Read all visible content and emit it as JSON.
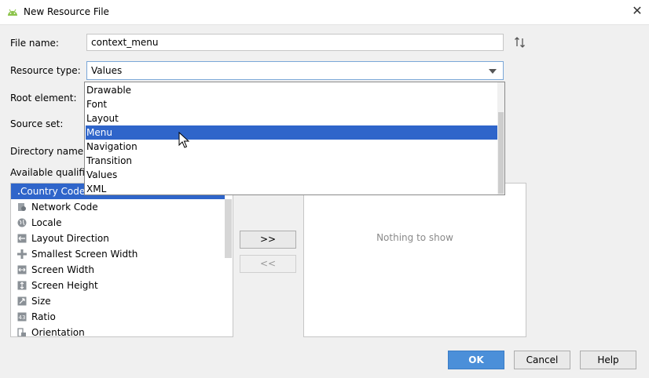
{
  "window": {
    "title": "New Resource File"
  },
  "form": {
    "file_name_label": "File name:",
    "file_name_value": "context_menu",
    "resource_type_label": "Resource type:",
    "resource_type_value": "Values",
    "root_element_label": "Root element:",
    "source_set_label": "Source set:",
    "directory_name_label": "Directory name:",
    "available_qualifiers_label": "Available qualifier"
  },
  "dropdown": {
    "options": [
      "Drawable",
      "Font",
      "Layout",
      "Menu",
      "Navigation",
      "Transition",
      "Values",
      "XML"
    ],
    "highlighted": "Menu"
  },
  "qualifiers": {
    "items": [
      {
        "label": "Country Code",
        "icon": "country-code-icon"
      },
      {
        "label": "Network Code",
        "icon": "network-code-icon"
      },
      {
        "label": "Locale",
        "icon": "globe-icon"
      },
      {
        "label": "Layout Direction",
        "icon": "layout-direction-icon"
      },
      {
        "label": "Smallest Screen Width",
        "icon": "smallest-width-icon"
      },
      {
        "label": "Screen Width",
        "icon": "screen-width-icon"
      },
      {
        "label": "Screen Height",
        "icon": "screen-height-icon"
      },
      {
        "label": "Size",
        "icon": "size-icon"
      },
      {
        "label": "Ratio",
        "icon": "ratio-icon"
      },
      {
        "label": "Orientation",
        "icon": "orientation-icon"
      }
    ],
    "selected": "Country Code"
  },
  "chosen": {
    "empty_text": "Nothing to show"
  },
  "buttons": {
    "add": ">>",
    "remove": "<<",
    "ok": "OK",
    "cancel": "Cancel",
    "help": "Help"
  },
  "colors": {
    "selection": "#2f65ca",
    "primary_button": "#4b8fd9"
  }
}
